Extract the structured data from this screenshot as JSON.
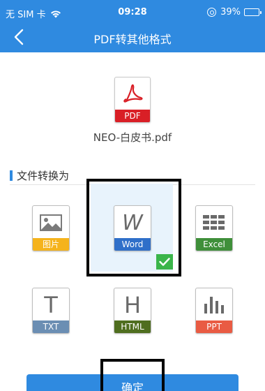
{
  "status_bar": {
    "carrier": "无 SIM 卡",
    "time": "09:28",
    "battery_percent": "39%",
    "battery_level": 0.39,
    "icons": [
      "wifi-icon",
      "orientation-lock-icon",
      "battery-icon"
    ]
  },
  "nav": {
    "title": "PDF转其他格式",
    "back_icon": "chevron-left-icon"
  },
  "source_file": {
    "type_label": "PDF",
    "name": "NEO-白皮书.pdf",
    "icon": "acrobat-icon"
  },
  "section": {
    "label": "文件转换为"
  },
  "formats": [
    {
      "id": "image",
      "label": "图片",
      "color": "#f5b31c",
      "icon": "image-icon"
    },
    {
      "id": "word",
      "label": "Word",
      "color": "#2f6fc9",
      "icon": "word-w-icon",
      "selected": true
    },
    {
      "id": "excel",
      "label": "Excel",
      "color": "#3f8f3a",
      "icon": "table-grid-icon"
    },
    {
      "id": "txt",
      "label": "TXT",
      "color": "#6b8eb3",
      "icon": "letter-t-icon"
    },
    {
      "id": "html",
      "label": "HTML",
      "color": "#4f6e1f",
      "icon": "letter-h-icon"
    },
    {
      "id": "ppt",
      "label": "PPT",
      "color": "#e95b43",
      "icon": "bar-chart-icon"
    }
  ],
  "confirm_button": {
    "label": "确定"
  },
  "colors": {
    "primary": "#2f8ae0",
    "selected_bg": "#e8f3fc",
    "check": "#3bb54a",
    "pdf_red": "#d91f26"
  }
}
